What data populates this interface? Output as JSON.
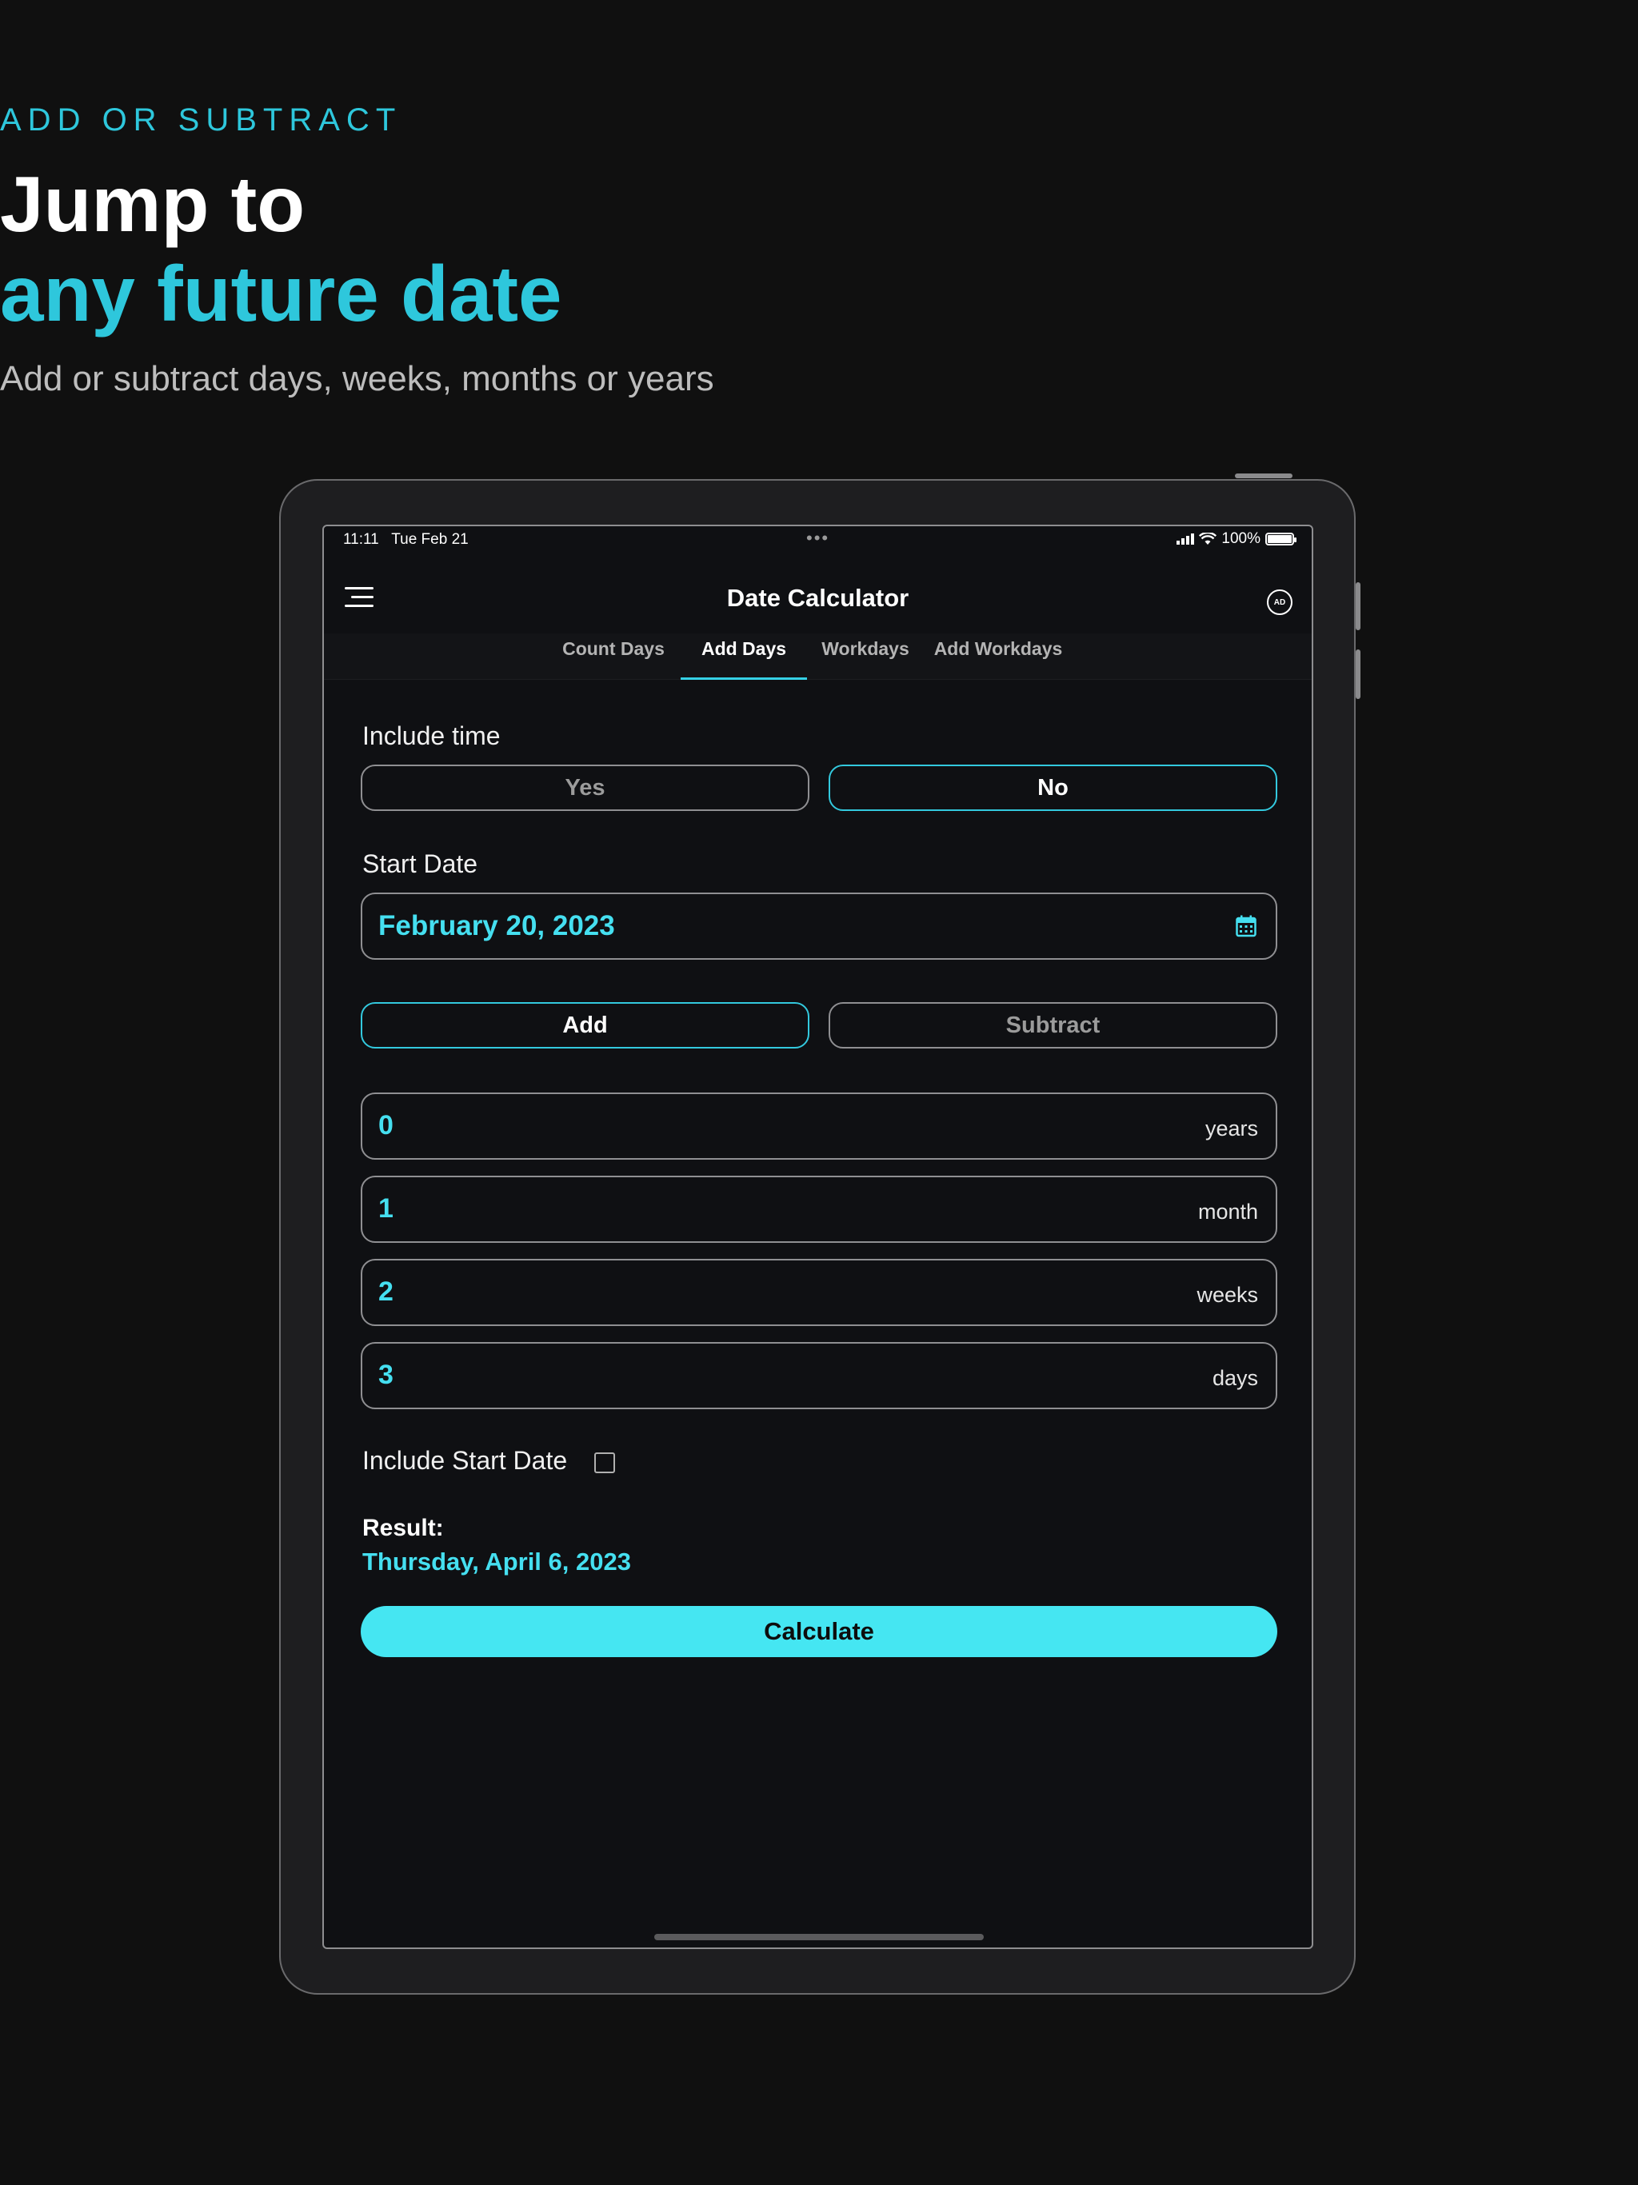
{
  "hero": {
    "eyebrow": "ADD OR SUBTRACT",
    "headline_line1": "Jump to",
    "headline_line2": "any future date",
    "subheadline": "Add or subtract days, weeks, months or years"
  },
  "status_bar": {
    "time": "11:11",
    "date": "Tue Feb 21",
    "battery": "100%"
  },
  "navbar": {
    "title": "Date Calculator",
    "ad_badge": "AD"
  },
  "tabs": [
    {
      "label": "Count Days",
      "active": false
    },
    {
      "label": "Add Days",
      "active": true
    },
    {
      "label": "Workdays",
      "active": false
    },
    {
      "label": "Add Workdays",
      "active": false
    }
  ],
  "include_time": {
    "label": "Include time",
    "yes_label": "Yes",
    "no_label": "No",
    "selected": "No"
  },
  "start_date": {
    "label": "Start Date",
    "value": "February 20, 2023"
  },
  "operation": {
    "add_label": "Add",
    "subtract_label": "Subtract",
    "selected": "Add"
  },
  "amounts": [
    {
      "value": "0",
      "unit": "years"
    },
    {
      "value": "1",
      "unit": "month"
    },
    {
      "value": "2",
      "unit": "weeks"
    },
    {
      "value": "3",
      "unit": "days"
    }
  ],
  "include_start_date": {
    "label": "Include Start Date",
    "checked": false
  },
  "result": {
    "label": "Result:",
    "value": "Thursday, April 6, 2023"
  },
  "calculate_label": "Calculate",
  "colors": {
    "accent": "#2ec7dc",
    "accent_button": "#45e6f2",
    "background": "#101010"
  }
}
